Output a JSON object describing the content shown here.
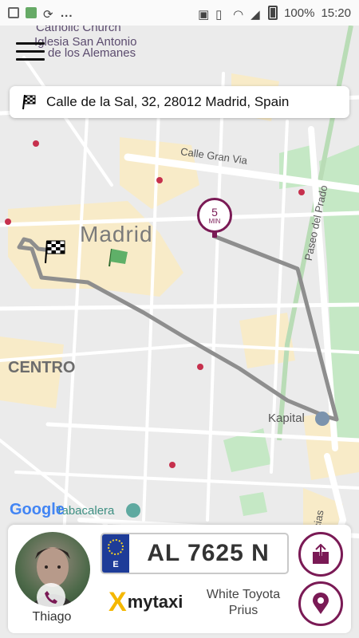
{
  "status_bar": {
    "left_icons": [
      "image-icon",
      "game-icon",
      "sync-icon"
    ],
    "overflow": "...",
    "right_icons": [
      "screenshot-icon",
      "vibrate-icon",
      "wifi-icon",
      "signal-icon"
    ],
    "battery": "100%",
    "time": "15:20"
  },
  "map": {
    "labels": {
      "catholic_church_1": "Catholic Church",
      "catholic_church_2": "Iglesia San Antonio",
      "catholic_church_3": "de los Alemanes",
      "calle_gran_via": "Calle Gran Via",
      "paseo_del_prado": "Paseo del Prado",
      "madrid": "Madrid",
      "centro": "CENTRO",
      "kapital": "Kapital",
      "tabacalera": "Tabacalera",
      "delicias": "elicias",
      "google": "Google"
    },
    "eta": {
      "value": "5",
      "unit": "MIN"
    },
    "colors": {
      "route": "#8e8e8e",
      "eta_accent": "#7a1a55",
      "road": "#ffffff",
      "park": "#c5e8c5",
      "block": "#f8ebc8"
    }
  },
  "header": {
    "menu_icon": "hamburger-icon"
  },
  "destination": {
    "icon": "checkered-flag-icon",
    "address": "Calle de la Sal, 32, 28012 Madrid, Spain"
  },
  "driver": {
    "name": "Thiago",
    "phone_icon": "phone-icon",
    "plate": {
      "country_code": "E",
      "number": "AL 7625 N"
    },
    "brand": {
      "mark": "X",
      "name": "mytaxi"
    },
    "car": {
      "line1": "White Toyota",
      "line2": "Prius"
    }
  },
  "actions": {
    "share_icon": "share-icon",
    "location_icon": "location-pin-icon"
  }
}
